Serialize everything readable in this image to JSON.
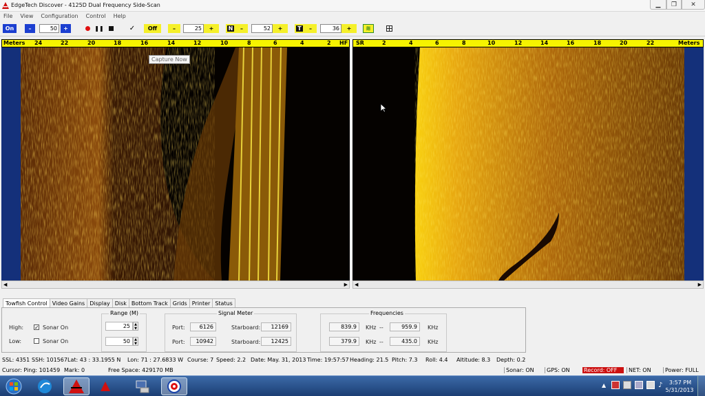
{
  "window": {
    "title": "EdgeTech  Discover - 4125D  Dual Frequency Side-Scan"
  },
  "menu": [
    "File",
    "View",
    "Configuration",
    "Control",
    "Help"
  ],
  "toolbar": {
    "power": "On",
    "range_minus": "–",
    "range_value": "50",
    "range_plus": "+",
    "confirm": "✓",
    "gain_mode": "Off",
    "gain_minus": "–",
    "gain_value": "25",
    "gain_plus": "+",
    "n_label": "N",
    "n_minus": "–",
    "n_value": "52",
    "n_plus": "+",
    "t_label": "T",
    "t_minus": "–",
    "t_value": "36",
    "t_plus": "+"
  },
  "port_ruler": {
    "unit": "Meters",
    "ticks": [
      "24",
      "22",
      "20",
      "18",
      "16",
      "14",
      "12",
      "10",
      "8",
      "6",
      "4",
      "2"
    ],
    "end": "HF"
  },
  "starboard_ruler": {
    "start": "SR",
    "ticks": [
      "2",
      "4",
      "6",
      "8",
      "10",
      "12",
      "14",
      "16",
      "18",
      "20",
      "22"
    ],
    "unit": "Meters"
  },
  "tooltip": "Capture Now",
  "tabs": [
    "Towfish Control",
    "Video Gains",
    "Display",
    "Disk",
    "Bottom Track",
    "Grids",
    "Printer",
    "Status"
  ],
  "towfish": {
    "high_label": "High:",
    "low_label": "Low:",
    "sonar_on_label": "Sonar On",
    "range_title": "Range (M)",
    "high_range": "25",
    "low_range": "50",
    "signal_title": "Signal Meter",
    "port_label": "Port:",
    "starboard_label": "Starboard:",
    "port_high": "6126",
    "starboard_high": "12169",
    "port_low": "10942",
    "starboard_low": "12425",
    "freq_title": "Frequencies",
    "f1": "839.9",
    "f2": "959.9",
    "f3": "379.9",
    "f4": "435.0",
    "khz": "KHz",
    "dash": "--"
  },
  "status1": {
    "ssl": "SSL: 4351",
    "ssh": "SSH: 101567",
    "lat": "Lat:   43 : 33.1955 N",
    "lon": "Lon:   71 : 27.6833 W",
    "course": "Course: 7",
    "speed": "Speed:  2.2",
    "date": "Date: May. 31, 2013",
    "time": "Time: 19:57:57",
    "heading": "Heading:  21.5",
    "pitch": "Pitch:   7.3",
    "roll": "Roll:   4.4",
    "altitude": "Altitude:   8.3",
    "depth": "Depth:    0.2"
  },
  "status2": {
    "cursor": "Cursor:  Ping:   101459",
    "mark": "Mark:      0",
    "free": "Free Space: 429170 MB",
    "sonar": "Sonar: ON",
    "gps": "GPS: ON",
    "record": "Record: OFF",
    "net": "NET: ON",
    "power": "Power: FULL"
  },
  "clock": {
    "time": "3:57 PM",
    "date": "5/31/2013"
  },
  "colors": {
    "ruler": "#f6f300",
    "record_off": "#cc1111",
    "power_btn": "#1c3fd0"
  }
}
